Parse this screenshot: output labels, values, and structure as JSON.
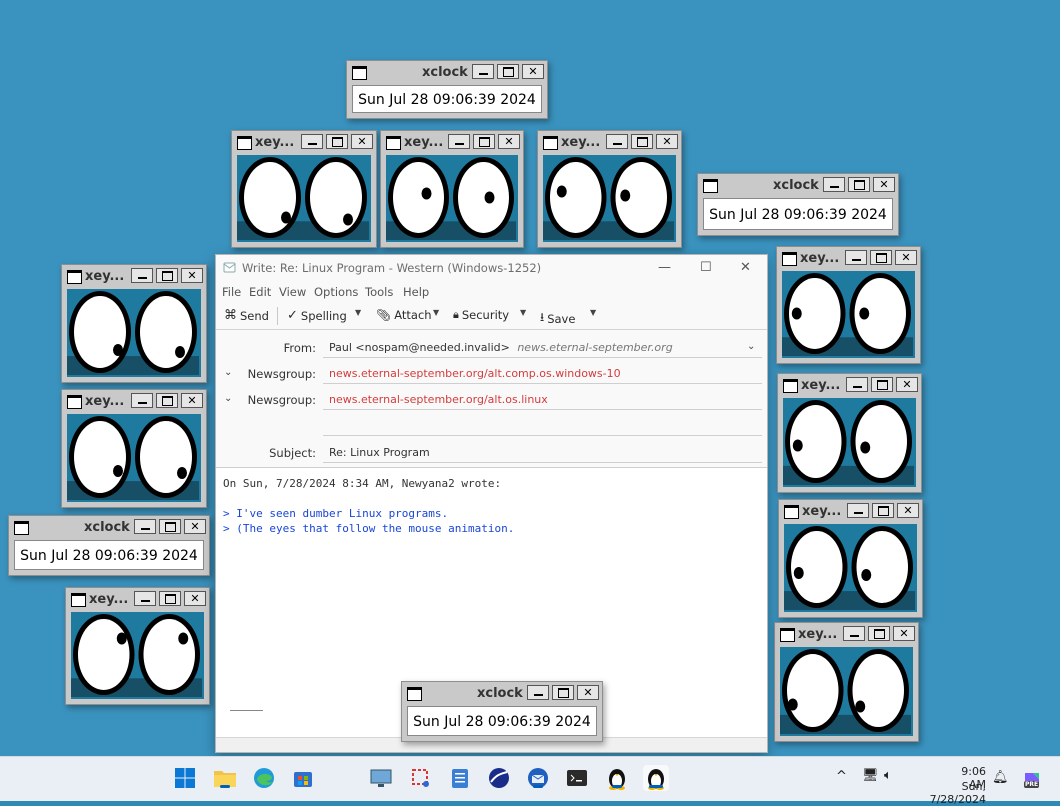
{
  "desktop": {
    "background": "#3a93bf"
  },
  "xclock": {
    "title": "xclock",
    "time": "Sun Jul 28 09:06:39 2024"
  },
  "xeyes": {
    "title": "xey..."
  },
  "thunderbird": {
    "title": "Write: Re: Linux Program - Western (Windows-1252)",
    "menu": [
      "File",
      "Edit",
      "View",
      "Options",
      "Tools",
      "Help"
    ],
    "toolbar": {
      "send": "Send",
      "spelling": "Spelling",
      "attach": "Attach",
      "security": "Security",
      "save": "Save"
    },
    "from_label": "From:",
    "from_value": "Paul <nospam@needed.invalid>",
    "from_account": "news.eternal-september.org",
    "newsgroup_label": "Newsgroup:",
    "newsgroup_1": "news.eternal-september.org/alt.comp.os.windows-10",
    "newsgroup_2": "news.eternal-september.org/alt.os.linux",
    "subject_label": "Subject:",
    "subject_value": "Re: Linux Program",
    "body": {
      "attribution": "On Sun, 7/28/2024 8:34 AM, Newyana2 wrote:",
      "quote_1": "> I've seen dumber Linux programs.",
      "quote_2": "> (The eyes that follow the mouse animation."
    },
    "accent_link": "#d43c3c",
    "quote_color": "#1a46d6"
  },
  "taskbar": {
    "icons": [
      "windows-start-icon",
      "file-explorer-icon",
      "edge-icon",
      "store-icon",
      "display-settings-icon",
      "snipping-tool-icon",
      "notepad-icon",
      "stellarium-icon",
      "thunderbird-icon",
      "terminal-icon",
      "linux-tux-icon",
      "linux-tux-icon"
    ],
    "time": "9:06 AM",
    "date": "Sun, 7/28/2024",
    "copilot_badge": "PRE"
  }
}
